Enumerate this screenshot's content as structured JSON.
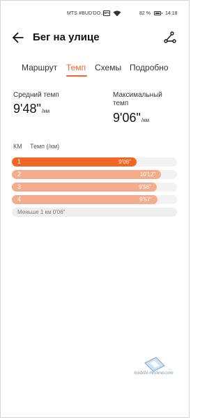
{
  "status_bar": {
    "carrier": "MTS #BUD'DO...",
    "nfc": "NFC",
    "battery_percent": "82 %",
    "battery_level": 0.82,
    "time": "14:18"
  },
  "header": {
    "title": "Бег на улице",
    "back_icon": "arrow-left-icon",
    "share_icon": "share-icon"
  },
  "tabs": [
    {
      "label": "Маршрут",
      "active": false
    },
    {
      "label": "Темп",
      "active": true
    },
    {
      "label": "Схемы",
      "active": false
    },
    {
      "label": "Подробно",
      "active": false
    }
  ],
  "stats": {
    "avg_label": "Средний темп",
    "avg_value": "9'48\"",
    "avg_unit": "/км",
    "max_label_line1": "Максимальный",
    "max_label_line2": "темп",
    "max_value": "9'06\"",
    "max_unit": "/км"
  },
  "splits": {
    "col_km": "КМ",
    "col_pace": "Темп (/км)",
    "rows": [
      {
        "index": "1",
        "pace": "9'06\"",
        "seconds": 546,
        "color": "#f26522"
      },
      {
        "index": "2",
        "pace": "10'12\"",
        "seconds": 612,
        "color": "#f4ad8c"
      },
      {
        "index": "3",
        "pace": "9'56\"",
        "seconds": 596,
        "color": "#f4ad8c"
      },
      {
        "index": "4",
        "pace": "9'57\"",
        "seconds": 597,
        "color": "#f4ad8c"
      }
    ],
    "less_than_km": "Меньше 1 км 0'06\""
  },
  "watermark": {
    "text": "mobile-review.com"
  },
  "colors": {
    "accent": "#f26522",
    "bar_light": "#f4ad8c"
  }
}
